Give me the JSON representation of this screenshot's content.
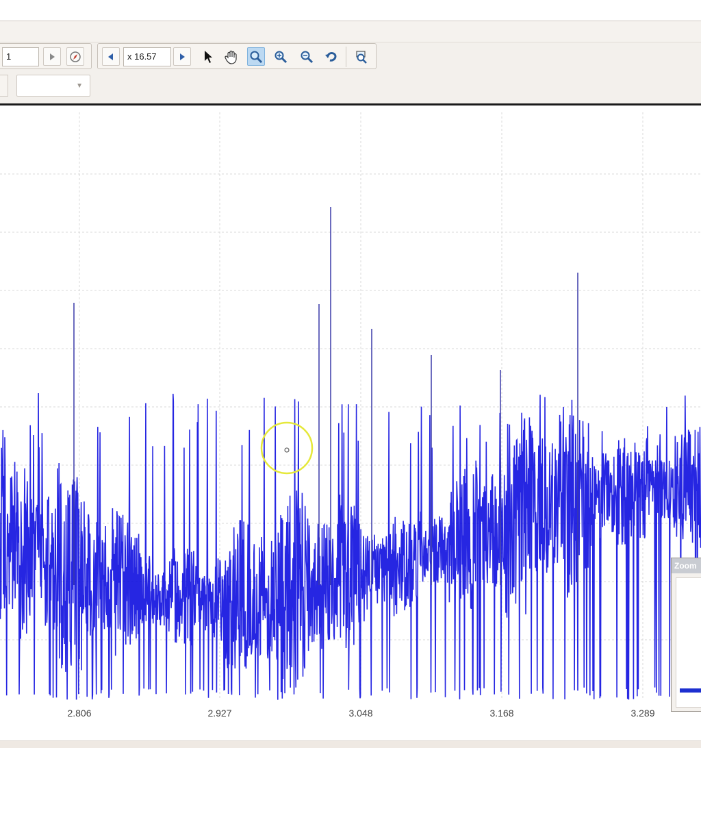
{
  "toolbar": {
    "page_value": "1",
    "zoom_factor": "x 16.57",
    "dropdown_value": "",
    "icons": {
      "next": "triangle-right-icon",
      "compass": "compass-icon",
      "prev_zoom": "triangle-left-icon",
      "next_zoom": "triangle-right-icon",
      "pointer": "arrow-cursor-icon",
      "pan": "hand-pan-icon",
      "zoom_select": "zoom-select-icon",
      "zoom_in": "zoom-in-icon",
      "zoom_out": "zoom-out-icon",
      "undo": "undo-icon",
      "zoom_reset": "zoom-reset-icon"
    }
  },
  "chart_data": {
    "type": "line",
    "title": "",
    "xlabel": "",
    "ylabel": "",
    "x_ticks": [
      "2.806",
      "2.927",
      "3.048",
      "3.168",
      "3.289"
    ],
    "x_range": [
      2.72,
      3.33
    ],
    "grid": true,
    "series": [
      {
        "values_note": "",
        "color": "#0000dd"
      }
    ]
  },
  "zoom_window": {
    "title": "Zoom"
  },
  "colors": {
    "signal": "#0000dd",
    "grid": "#d8d8d8",
    "active_tool": "#bcd9f2"
  }
}
